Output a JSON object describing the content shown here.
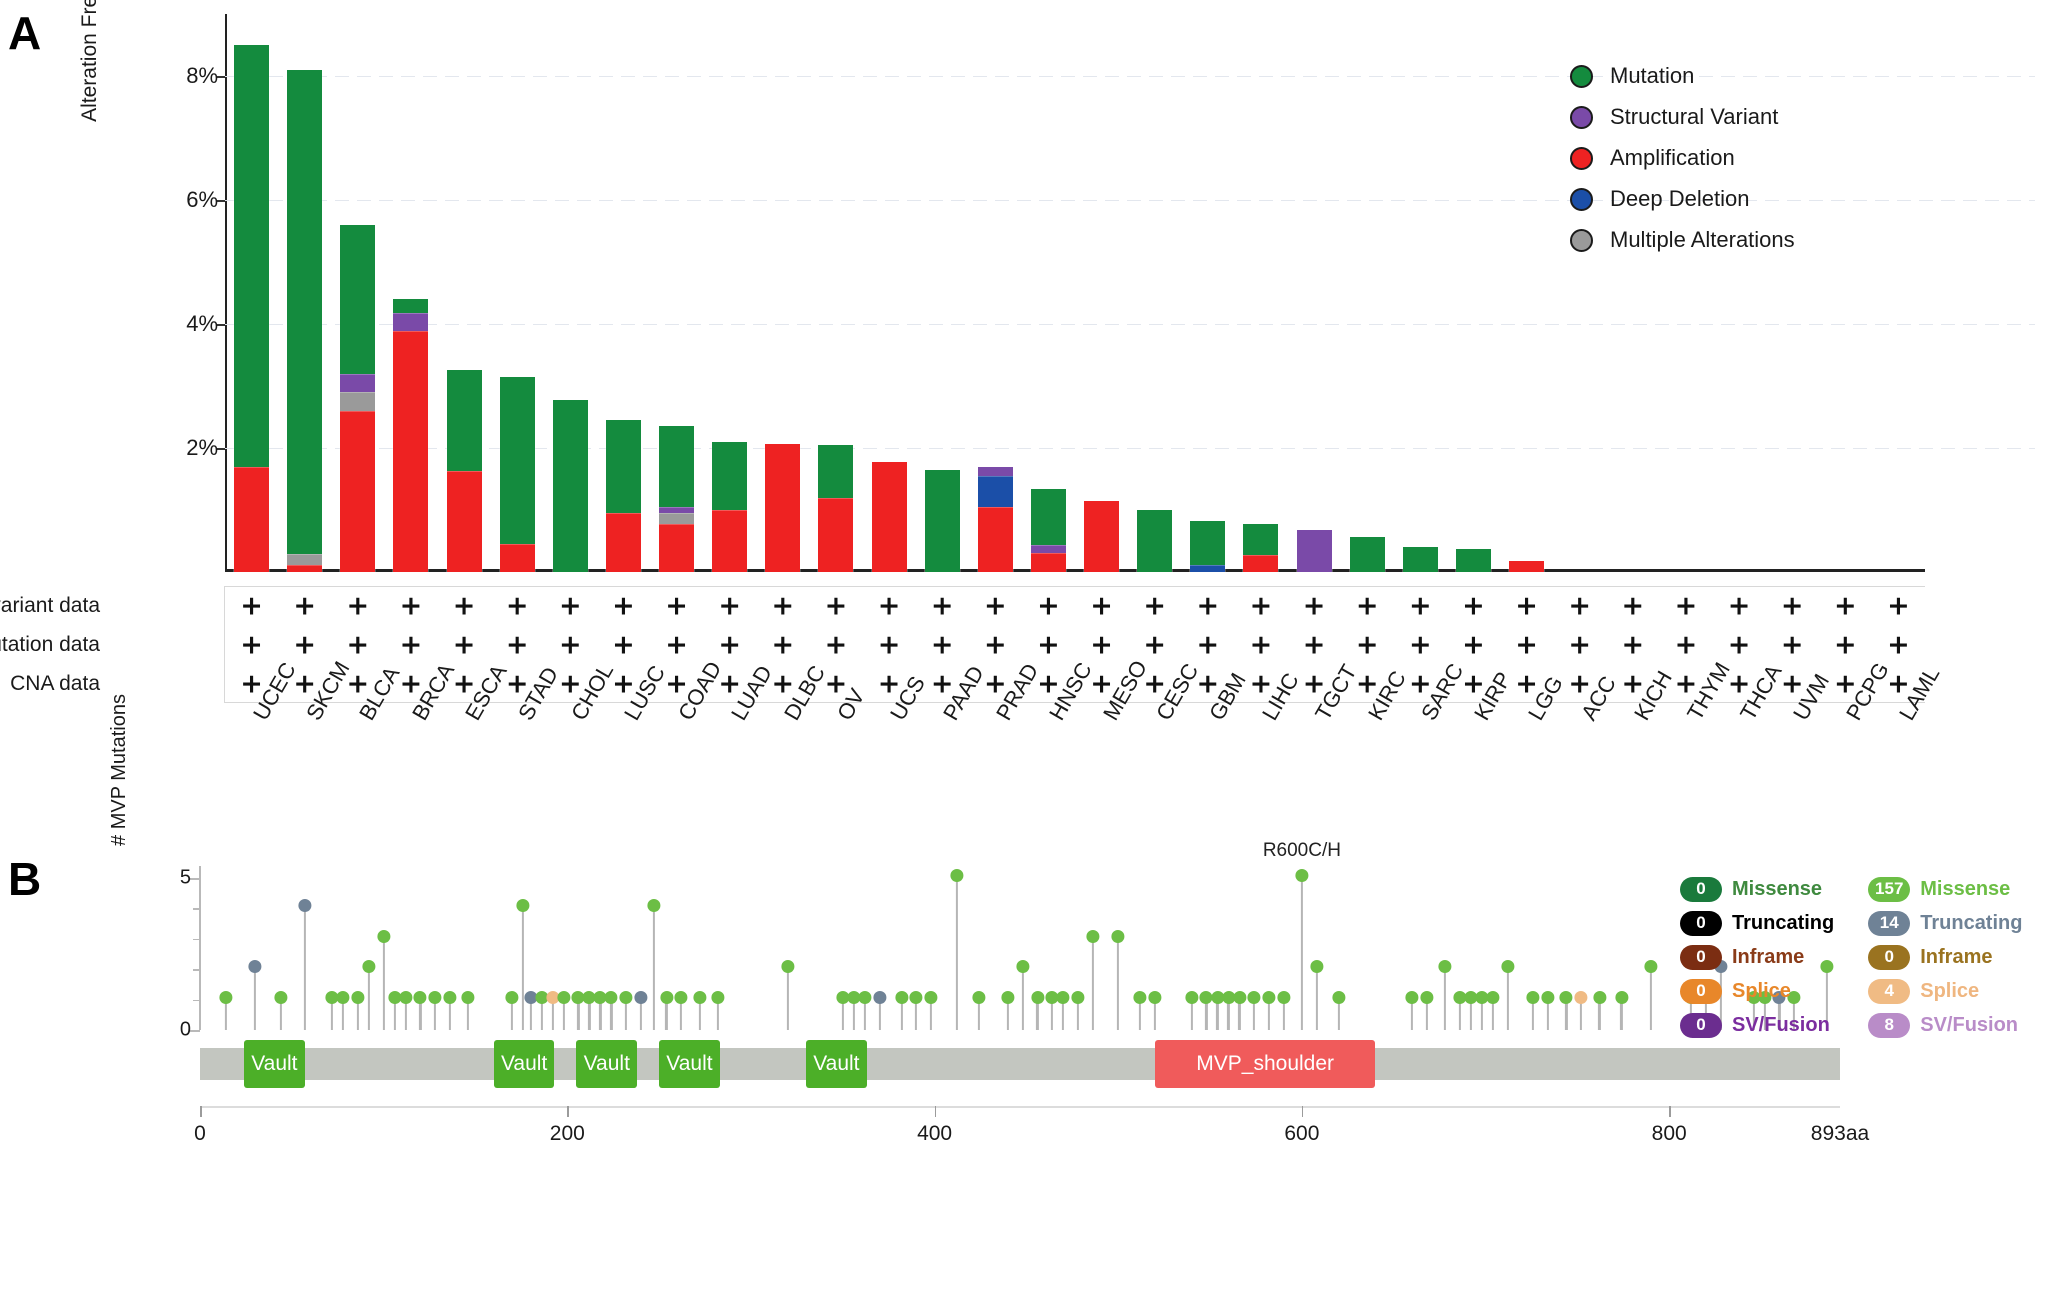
{
  "panels": {
    "a_letter": "A",
    "b_letter": "B"
  },
  "panelA": {
    "ylabel": "Alteration Frequency",
    "y_ticks": [
      "2%",
      "4%",
      "6%",
      "8%"
    ],
    "row_labels": [
      "Structural variant data",
      "Mutation data",
      "CNA data"
    ],
    "plus_symbol": "+",
    "legend": [
      {
        "label": "Mutation",
        "color": "#148b3e"
      },
      {
        "label": "Structural Variant",
        "color": "#7a4aa8"
      },
      {
        "label": "Amplification",
        "color": "#ee2222"
      },
      {
        "label": "Deep Deletion",
        "color": "#1b4fa8"
      },
      {
        "label": "Multiple Alterations",
        "color": "#9a9a9a"
      }
    ]
  },
  "chart_data": [
    {
      "type": "bar",
      "title": "",
      "xlabel": "",
      "ylabel": "Alteration Frequency",
      "ylim": [
        0,
        9
      ],
      "y_tick_values": [
        2,
        4,
        6,
        8
      ],
      "grid": true,
      "stacked": true,
      "legend_position": "top-right",
      "categories": [
        "UCEC",
        "SKCM",
        "BLCA",
        "BRCA",
        "ESCA",
        "STAD",
        "CHOL",
        "LUSC",
        "COAD",
        "LUAD",
        "DLBC",
        "OV",
        "UCS",
        "PAAD",
        "PRAD",
        "HNSC",
        "MESO",
        "CESC",
        "GBM",
        "LIHC",
        "TGCT",
        "KIRC",
        "SARC",
        "KIRP",
        "LGG",
        "ACC",
        "KICH",
        "THYM",
        "THCA",
        "UVM",
        "PCPG",
        "LAML"
      ],
      "series": [
        {
          "name": "Amplification",
          "color": "#ee2222",
          "values": [
            1.7,
            0.12,
            2.6,
            3.88,
            1.63,
            0.45,
            0.0,
            0.95,
            0.78,
            1.0,
            2.06,
            1.2,
            1.78,
            0.0,
            1.05,
            0.3,
            1.14,
            0.0,
            0.0,
            0.28,
            0.0,
            0.0,
            0.0,
            0.0,
            0.17,
            0,
            0,
            0,
            0,
            0,
            0,
            0
          ]
        },
        {
          "name": "Deep Deletion",
          "color": "#1b4fa8",
          "values": [
            0,
            0,
            0,
            0,
            0,
            0,
            0,
            0,
            0,
            0,
            0,
            0,
            0,
            0,
            0.5,
            0.0,
            0,
            0,
            0.12,
            0,
            0,
            0,
            0,
            0,
            0,
            0,
            0,
            0,
            0,
            0,
            0,
            0
          ]
        },
        {
          "name": "Multiple Alterations",
          "color": "#9a9a9a",
          "values": [
            0,
            0.17,
            0.3,
            0,
            0,
            0,
            0,
            0,
            0.17,
            0,
            0,
            0,
            0,
            0,
            0,
            0,
            0,
            0,
            0,
            0,
            0,
            0,
            0,
            0,
            0,
            0,
            0,
            0,
            0,
            0,
            0,
            0
          ]
        },
        {
          "name": "Structural Variant",
          "color": "#7a4aa8",
          "values": [
            0,
            0,
            0.3,
            0.3,
            0,
            0,
            0,
            0,
            0.1,
            0,
            0,
            0,
            0,
            0,
            0.14,
            0.14,
            0,
            0,
            0,
            0,
            0.68,
            0,
            0,
            0,
            0,
            0,
            0,
            0,
            0,
            0,
            0,
            0
          ]
        },
        {
          "name": "Mutation",
          "color": "#148b3e",
          "values": [
            6.8,
            7.8,
            2.4,
            0.22,
            1.63,
            2.7,
            2.78,
            1.5,
            1.31,
            1.1,
            0.0,
            0.85,
            0.0,
            1.65,
            0.0,
            0.9,
            0.0,
            1.0,
            0.7,
            0.5,
            0.0,
            0.57,
            0.4,
            0.37,
            0.0,
            0,
            0,
            0,
            0,
            0,
            0,
            0
          ]
        }
      ],
      "totals": [
        8.5,
        8.09,
        5.6,
        4.4,
        3.26,
        3.15,
        2.78,
        2.45,
        2.36,
        2.1,
        2.06,
        2.05,
        1.78,
        1.65,
        1.4,
        1.34,
        1.14,
        1.0,
        0.82,
        0.78,
        0.68,
        0.57,
        0.4,
        0.37,
        0.17,
        0,
        0,
        0,
        0,
        0,
        0,
        0
      ]
    },
    {
      "type": "lollipop",
      "title": "",
      "ylabel": "# MVP Mutations",
      "xlabel": "",
      "ylim": [
        0,
        5
      ],
      "y_tick_values": [
        0,
        5
      ],
      "xlim": [
        0,
        893
      ],
      "x_ticks": [
        0,
        200,
        400,
        600,
        800
      ],
      "x_end_label": "893aa",
      "protein_length": 893,
      "annotations": [
        {
          "label": "R600C/H",
          "x": 600,
          "y": 5
        }
      ],
      "domains": [
        {
          "name": "Vault",
          "start": 24,
          "end": 57,
          "color": "#4caf28"
        },
        {
          "name": "Vault",
          "start": 160,
          "end": 193,
          "color": "#4caf28"
        },
        {
          "name": "Vault",
          "start": 205,
          "end": 238,
          "color": "#4caf28"
        },
        {
          "name": "Vault",
          "start": 250,
          "end": 283,
          "color": "#4caf28"
        },
        {
          "name": "Vault",
          "start": 330,
          "end": 363,
          "color": "#4caf28"
        },
        {
          "name": "MVP_shoulder",
          "start": 520,
          "end": 640,
          "color": "#f05b5b"
        }
      ],
      "mutations": [
        {
          "x": 14,
          "y": 1,
          "type": "Missense"
        },
        {
          "x": 30,
          "y": 2,
          "type": "Truncating"
        },
        {
          "x": 44,
          "y": 1,
          "type": "Missense"
        },
        {
          "x": 57,
          "y": 4,
          "type": "Truncating"
        },
        {
          "x": 72,
          "y": 1,
          "type": "Missense"
        },
        {
          "x": 78,
          "y": 1,
          "type": "Missense"
        },
        {
          "x": 86,
          "y": 1,
          "type": "Missense"
        },
        {
          "x": 92,
          "y": 2,
          "type": "Missense"
        },
        {
          "x": 100,
          "y": 3,
          "type": "Missense"
        },
        {
          "x": 106,
          "y": 1,
          "type": "Missense"
        },
        {
          "x": 112,
          "y": 1,
          "type": "Missense"
        },
        {
          "x": 120,
          "y": 1,
          "type": "Missense"
        },
        {
          "x": 128,
          "y": 1,
          "type": "Missense"
        },
        {
          "x": 136,
          "y": 1,
          "type": "Missense"
        },
        {
          "x": 146,
          "y": 1,
          "type": "Missense"
        },
        {
          "x": 170,
          "y": 1,
          "type": "Missense"
        },
        {
          "x": 176,
          "y": 4,
          "type": "Missense"
        },
        {
          "x": 180,
          "y": 1,
          "type": "Truncating"
        },
        {
          "x": 186,
          "y": 1,
          "type": "Missense"
        },
        {
          "x": 192,
          "y": 1,
          "type": "Splice"
        },
        {
          "x": 198,
          "y": 1,
          "type": "Missense"
        },
        {
          "x": 206,
          "y": 1,
          "type": "Missense"
        },
        {
          "x": 212,
          "y": 1,
          "type": "Missense"
        },
        {
          "x": 218,
          "y": 1,
          "type": "Missense"
        },
        {
          "x": 224,
          "y": 1,
          "type": "Missense"
        },
        {
          "x": 232,
          "y": 1,
          "type": "Missense"
        },
        {
          "x": 240,
          "y": 1,
          "type": "Truncating"
        },
        {
          "x": 247,
          "y": 4,
          "type": "Missense"
        },
        {
          "x": 254,
          "y": 1,
          "type": "Missense"
        },
        {
          "x": 262,
          "y": 1,
          "type": "Missense"
        },
        {
          "x": 272,
          "y": 1,
          "type": "Missense"
        },
        {
          "x": 282,
          "y": 1,
          "type": "Missense"
        },
        {
          "x": 320,
          "y": 2,
          "type": "Missense"
        },
        {
          "x": 350,
          "y": 1,
          "type": "Missense"
        },
        {
          "x": 356,
          "y": 1,
          "type": "Missense"
        },
        {
          "x": 362,
          "y": 1,
          "type": "Missense"
        },
        {
          "x": 370,
          "y": 1,
          "type": "Truncating"
        },
        {
          "x": 382,
          "y": 1,
          "type": "Missense"
        },
        {
          "x": 390,
          "y": 1,
          "type": "Missense"
        },
        {
          "x": 398,
          "y": 1,
          "type": "Missense"
        },
        {
          "x": 412,
          "y": 5,
          "type": "Missense"
        },
        {
          "x": 424,
          "y": 1,
          "type": "Missense"
        },
        {
          "x": 440,
          "y": 1,
          "type": "Missense"
        },
        {
          "x": 448,
          "y": 2,
          "type": "Missense"
        },
        {
          "x": 456,
          "y": 1,
          "type": "Missense"
        },
        {
          "x": 464,
          "y": 1,
          "type": "Missense"
        },
        {
          "x": 470,
          "y": 1,
          "type": "Missense"
        },
        {
          "x": 478,
          "y": 1,
          "type": "Missense"
        },
        {
          "x": 486,
          "y": 3,
          "type": "Missense"
        },
        {
          "x": 500,
          "y": 3,
          "type": "Missense"
        },
        {
          "x": 512,
          "y": 1,
          "type": "Missense"
        },
        {
          "x": 520,
          "y": 1,
          "type": "Missense"
        },
        {
          "x": 540,
          "y": 1,
          "type": "Missense"
        },
        {
          "x": 548,
          "y": 1,
          "type": "Missense"
        },
        {
          "x": 554,
          "y": 1,
          "type": "Missense"
        },
        {
          "x": 560,
          "y": 1,
          "type": "Missense"
        },
        {
          "x": 566,
          "y": 1,
          "type": "Missense"
        },
        {
          "x": 574,
          "y": 1,
          "type": "Missense"
        },
        {
          "x": 582,
          "y": 1,
          "type": "Missense"
        },
        {
          "x": 590,
          "y": 1,
          "type": "Missense"
        },
        {
          "x": 600,
          "y": 5,
          "type": "Missense"
        },
        {
          "x": 608,
          "y": 2,
          "type": "Missense"
        },
        {
          "x": 620,
          "y": 1,
          "type": "Missense"
        },
        {
          "x": 660,
          "y": 1,
          "type": "Missense"
        },
        {
          "x": 668,
          "y": 1,
          "type": "Missense"
        },
        {
          "x": 678,
          "y": 2,
          "type": "Missense"
        },
        {
          "x": 686,
          "y": 1,
          "type": "Missense"
        },
        {
          "x": 692,
          "y": 1,
          "type": "Missense"
        },
        {
          "x": 698,
          "y": 1,
          "type": "Missense"
        },
        {
          "x": 704,
          "y": 1,
          "type": "Missense"
        },
        {
          "x": 712,
          "y": 2,
          "type": "Missense"
        },
        {
          "x": 726,
          "y": 1,
          "type": "Missense"
        },
        {
          "x": 734,
          "y": 1,
          "type": "Missense"
        },
        {
          "x": 744,
          "y": 1,
          "type": "Missense"
        },
        {
          "x": 752,
          "y": 1,
          "type": "Splice"
        },
        {
          "x": 762,
          "y": 1,
          "type": "Missense"
        },
        {
          "x": 774,
          "y": 1,
          "type": "Missense"
        },
        {
          "x": 790,
          "y": 2,
          "type": "Missense"
        },
        {
          "x": 812,
          "y": 1,
          "type": "Missense"
        },
        {
          "x": 820,
          "y": 1,
          "type": "Missense"
        },
        {
          "x": 828,
          "y": 2,
          "type": "Truncating"
        },
        {
          "x": 846,
          "y": 1,
          "type": "Missense"
        },
        {
          "x": 852,
          "y": 1,
          "type": "Missense"
        },
        {
          "x": 860,
          "y": 1,
          "type": "Truncating"
        },
        {
          "x": 868,
          "y": 1,
          "type": "Missense"
        },
        {
          "x": 886,
          "y": 2,
          "type": "Missense"
        }
      ]
    }
  ],
  "panelB": {
    "ylabel": "# MVP Mutations",
    "y_ticks": [
      "5",
      "0"
    ],
    "x_tick_labels": [
      "0",
      "200",
      "400",
      "600",
      "800",
      "893aa"
    ],
    "annotation": "R600C/H",
    "legend_left": [
      {
        "count": "0",
        "label": "Missense",
        "pill": "#1a7a3c",
        "text": "#3f8a3f"
      },
      {
        "count": "0",
        "label": "Truncating",
        "pill": "#000000",
        "text": "#000000"
      },
      {
        "count": "0",
        "label": "Inframe",
        "pill": "#7b2d12",
        "text": "#8a3b18"
      },
      {
        "count": "0",
        "label": "Splice",
        "pill": "#e8872a",
        "text": "#e8872a"
      },
      {
        "count": "0",
        "label": "SV/Fusion",
        "pill": "#6b2d8f",
        "text": "#7b2d9f"
      }
    ],
    "legend_right": [
      {
        "count": "157",
        "label": "Missense",
        "pill": "#6cbe45",
        "text": "#6cbe45"
      },
      {
        "count": "14",
        "label": "Truncating",
        "pill": "#6f8296",
        "text": "#6f8296"
      },
      {
        "count": "0",
        "label": "Inframe",
        "pill": "#9a7320",
        "text": "#9a7320"
      },
      {
        "count": "4",
        "label": "Splice",
        "pill": "#f0bb84",
        "text": "#efb680"
      },
      {
        "count": "8",
        "label": "SV/Fusion",
        "pill": "#b98cc8",
        "text": "#b98cc8"
      }
    ],
    "mutation_colors": {
      "Missense": "#6cbe45",
      "Truncating": "#6f8296",
      "Splice": "#f0bb84",
      "Inframe": "#9a7320",
      "SV/Fusion": "#b98cc8"
    }
  }
}
